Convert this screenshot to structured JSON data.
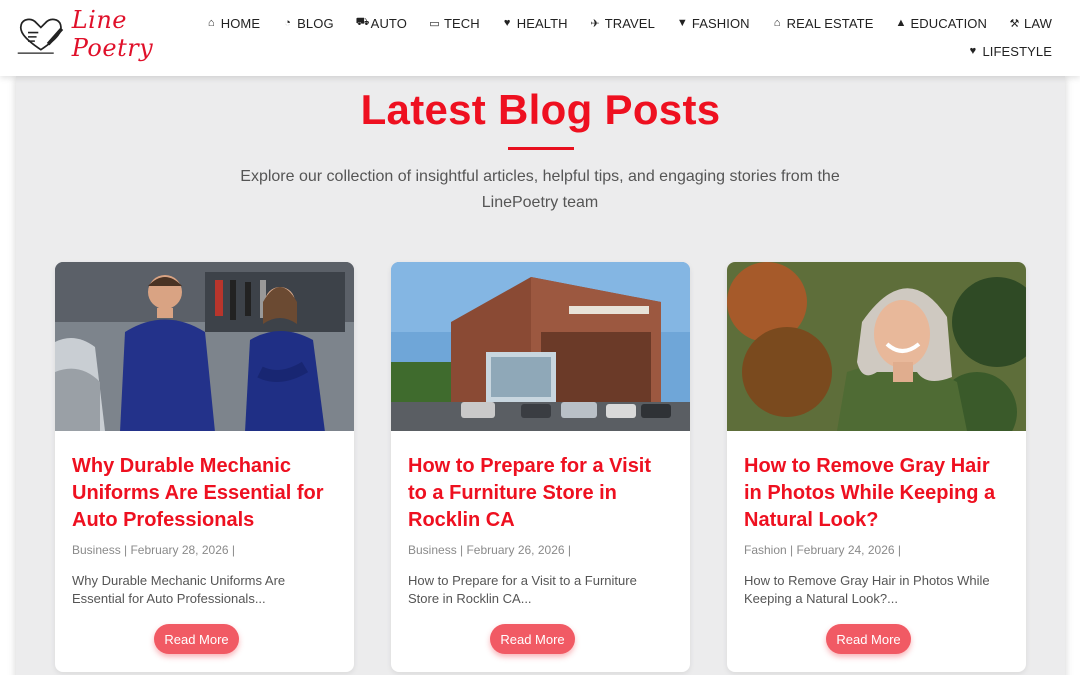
{
  "brand": {
    "name": "Line Poetry",
    "accent": "#ee1020"
  },
  "nav": {
    "items": [
      {
        "label": "HOME",
        "icon": "home-icon",
        "glyph": "⌂"
      },
      {
        "label": "BLOG",
        "icon": "feed-icon",
        "glyph": "◔"
      },
      {
        "label": "AUTO",
        "icon": "car-icon",
        "glyph": "⛟"
      },
      {
        "label": "TECH",
        "icon": "laptop-icon",
        "glyph": "▭"
      },
      {
        "label": "HEALTH",
        "icon": "heart-icon",
        "glyph": "♥"
      },
      {
        "label": "TRAVEL",
        "icon": "plane-icon",
        "glyph": "✈"
      },
      {
        "label": "FASHION",
        "icon": "tshirt-icon",
        "glyph": "▼"
      },
      {
        "label": "REAL ESTATE",
        "icon": "home-icon",
        "glyph": "⌂"
      },
      {
        "label": "EDUCATION",
        "icon": "graduation-cap-icon",
        "glyph": "▲"
      },
      {
        "label": "LAW",
        "icon": "gavel-icon",
        "glyph": "⚒"
      },
      {
        "label": "LIFESTYLE",
        "icon": "heart-icon",
        "glyph": "♥"
      }
    ]
  },
  "main": {
    "title": "Latest Blog Posts",
    "intro": "Explore our collection of insightful articles, helpful tips, and engaging stories from the LinePoetry team"
  },
  "cards": [
    {
      "title": "Why Durable Mechanic Uniforms Are Essential for Auto Professionals",
      "meta": "Business | February 28, 2026 |",
      "excerpt": "Why Durable Mechanic Uniforms Are Essential for Auto Professionals...",
      "button": "Read More",
      "image": "mechanics-photo"
    },
    {
      "title": "How to Prepare for a Visit to a Furniture Store in Rocklin CA",
      "meta": "Business | February 26, 2026 |",
      "excerpt": "How to Prepare for a Visit to a Furniture Store in Rocklin CA...",
      "button": "Read More",
      "image": "store-building-photo"
    },
    {
      "title": "How to Remove Gray Hair in Photos While Keeping a Natural Look?",
      "meta": "Fashion | February 24, 2026 |",
      "excerpt": "How to Remove Gray Hair in Photos While Keeping a Natural Look?...",
      "button": "Read More",
      "image": "gray-hair-woman-photo"
    }
  ]
}
